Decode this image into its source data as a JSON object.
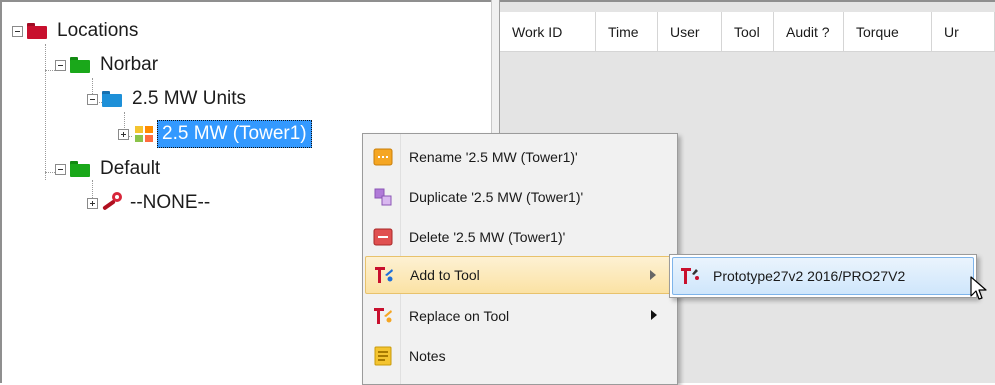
{
  "tree": {
    "root": {
      "label": "Locations",
      "icon": "red-folder-icon"
    },
    "company": {
      "label": "Norbar",
      "icon": "green-folder-icon"
    },
    "units": {
      "label": "2.5 MW Units",
      "icon": "blue-folder-icon"
    },
    "tower": {
      "label": "2.5 MW (Tower1)",
      "icon": "multicolor-grid-icon",
      "selected": true
    },
    "default": {
      "label": "Default",
      "icon": "green-folder-icon"
    },
    "none_tool": {
      "label": "--NONE--",
      "icon": "torque-wrench-icon"
    }
  },
  "grid": {
    "columns": [
      "Work ID",
      "Time",
      "User",
      "Tool",
      "Audit ?",
      "Torque",
      "Ur"
    ]
  },
  "context_menu": {
    "items": [
      {
        "label": "Rename '2.5 MW (Tower1)'",
        "icon": "rename-icon"
      },
      {
        "label": "Duplicate '2.5 MW (Tower1)'",
        "icon": "duplicate-icon"
      },
      {
        "label": "Delete '2.5 MW (Tower1)'",
        "icon": "delete-icon"
      },
      {
        "label": "Add to Tool",
        "icon": "tool-icon",
        "has_submenu": true,
        "highlighted": true
      },
      {
        "label": "Replace on Tool",
        "icon": "tool-icon",
        "has_submenu": true
      },
      {
        "label": "Notes",
        "icon": "notes-icon"
      }
    ]
  },
  "submenu": {
    "items": [
      {
        "label": "Prototype27v2 2016/PRO27V2",
        "icon": "tool-icon",
        "highlighted": true
      }
    ]
  },
  "colors": {
    "selection": "#3399ff",
    "menu_highlight": "#fbe2a4",
    "submenu_highlight": "#cfe6fb",
    "red_folder": "#c8102e",
    "green_folder": "#1aa81a",
    "blue_folder": "#1e90d8"
  }
}
